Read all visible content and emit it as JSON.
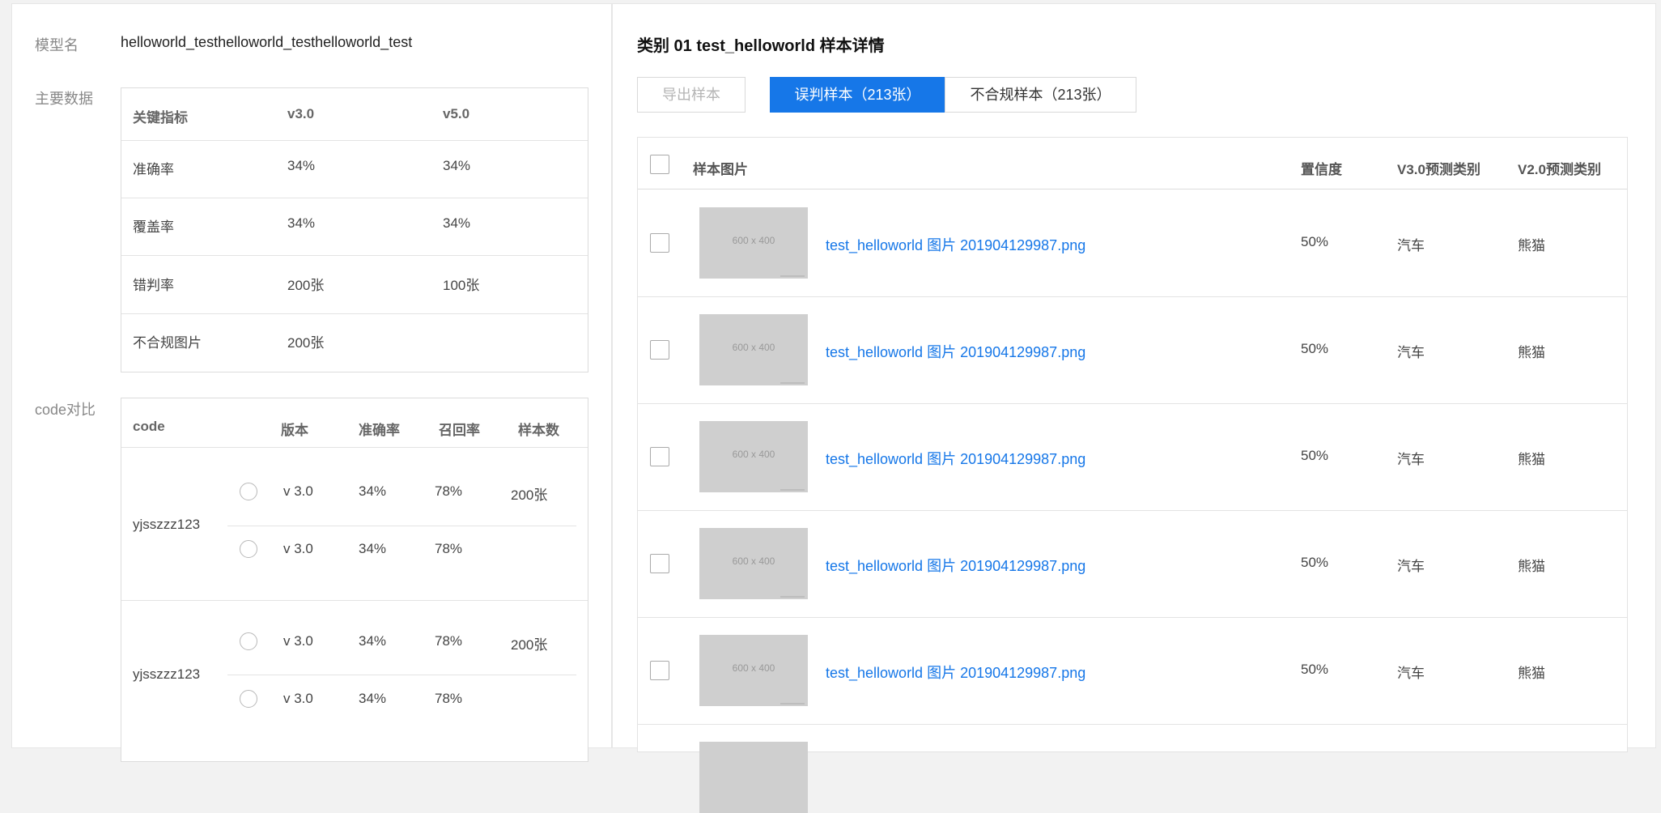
{
  "left": {
    "model_label": "模型名",
    "model_value": "helloworld_testhelloworld_testhelloworld_test",
    "main_label": "主要数据",
    "main_table": {
      "headers": [
        "关键指标",
        "v3.0",
        "v5.0"
      ],
      "rows": [
        [
          "准确率",
          "34%",
          "34%"
        ],
        [
          "覆盖率",
          "34%",
          "34%"
        ],
        [
          "错判率",
          "200张",
          "100张"
        ],
        [
          "不合规图片",
          "200张",
          ""
        ]
      ]
    },
    "code_label": "code对比",
    "code_table": {
      "headers": [
        "code",
        "版本",
        "准确率",
        "召回率",
        "样本数"
      ],
      "groups": [
        {
          "code": "yjsszzz123",
          "rows": [
            {
              "version": "v 3.0",
              "precision": "34%",
              "recall": "78%",
              "samples": "200张"
            },
            {
              "version": "v 3.0",
              "precision": "34%",
              "recall": "78%",
              "samples": ""
            }
          ]
        },
        {
          "code": "yjsszzz123",
          "rows": [
            {
              "version": "v 3.0",
              "precision": "34%",
              "recall": "78%",
              "samples": "200张"
            },
            {
              "version": "v 3.0",
              "precision": "34%",
              "recall": "78%",
              "samples": ""
            }
          ]
        }
      ]
    }
  },
  "right": {
    "title": "类别 01 test_helloworld 样本详情",
    "buttons": {
      "export": "导出样本",
      "misjudged": "误判样本（213张）",
      "noncompliant": "不合规样本（213张）"
    },
    "table": {
      "headers": [
        "样本图片",
        "置信度",
        "V3.0预测类别",
        "V2.0预测类别"
      ],
      "thumb_text": "600 x 400",
      "rows": [
        {
          "file": "test_helloworld 图片 201904129987.png",
          "confidence": "50%",
          "v3": "汽车",
          "v2": "熊猫"
        },
        {
          "file": "test_helloworld 图片 201904129987.png",
          "confidence": "50%",
          "v3": "汽车",
          "v2": "熊猫"
        },
        {
          "file": "test_helloworld 图片 201904129987.png",
          "confidence": "50%",
          "v3": "汽车",
          "v2": "熊猫"
        },
        {
          "file": "test_helloworld 图片 201904129987.png",
          "confidence": "50%",
          "v3": "汽车",
          "v2": "熊猫"
        },
        {
          "file": "test_helloworld 图片 201904129987.png",
          "confidence": "50%",
          "v3": "汽车",
          "v2": "熊猫"
        }
      ]
    }
  },
  "colors": {
    "accent": "#1677e8",
    "background": "#f2f2f2",
    "border": "#dcdcdc"
  }
}
